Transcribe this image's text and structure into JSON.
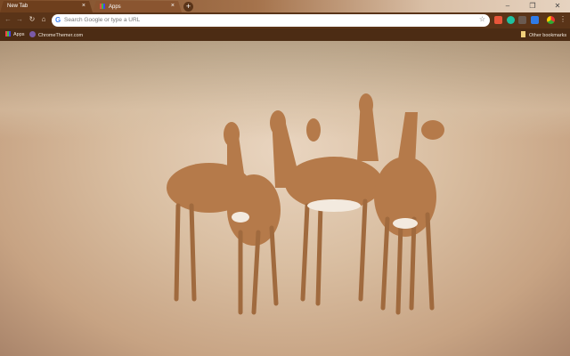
{
  "tabs": [
    {
      "label": "New Tab",
      "close": "×"
    },
    {
      "label": "Apps",
      "close": "×"
    }
  ],
  "new_tab": "+",
  "window_controls": {
    "minimize": "–",
    "maximize": "❐",
    "close": "✕"
  },
  "toolbar": {
    "back": "←",
    "forward": "→",
    "reload": "↻",
    "home": "⌂",
    "omnibox_placeholder": "Search Google or type a URL",
    "google_g": "G",
    "star": "☆",
    "menu": "⋮"
  },
  "bookmarks": {
    "apps": "Apps",
    "chrometheme": "ChromeThemer.com",
    "other": "Other bookmarks"
  },
  "colors": {
    "frame": "#6e3f1d",
    "toolbar": "#5a3418",
    "bookmarks": "#4c2c14"
  }
}
